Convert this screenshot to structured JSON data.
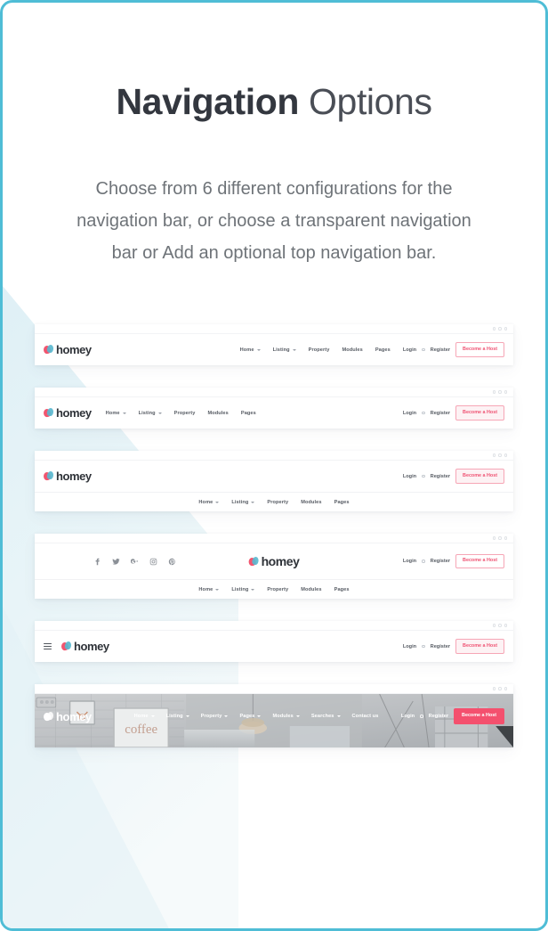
{
  "theme": {
    "frame_border_color": "#4fbdd6",
    "accent_pink": "#f4506e",
    "wedge_color": "#e4f3f7",
    "title_color": "#33373f",
    "body_text_color": "#6e7378"
  },
  "header": {
    "title_bold": "Navigation",
    "title_light": "Options",
    "subtitle": "Choose from 6 different configurations for the navigation bar, or choose a transparent navigation bar or Add an optional top navigation bar."
  },
  "brand": {
    "name": "homey",
    "logo_icon": "heart-logo-icon"
  },
  "common": {
    "login_label": "Login",
    "register_label": "Register",
    "host_button_label": "Become a Host",
    "window_dots": 3
  },
  "menus": {
    "standard": [
      {
        "label": "Home",
        "has_caret": true
      },
      {
        "label": "Listing",
        "has_caret": true
      },
      {
        "label": "Property",
        "has_caret": false
      },
      {
        "label": "Modules",
        "has_caret": false
      },
      {
        "label": "Pages",
        "has_caret": false
      }
    ],
    "extended": [
      {
        "label": "Home",
        "has_caret": true
      },
      {
        "label": "Listing",
        "has_caret": true
      },
      {
        "label": "Property",
        "has_caret": true
      },
      {
        "label": "Pages",
        "has_caret": true
      },
      {
        "label": "Modules",
        "has_caret": true
      },
      {
        "label": "Searches",
        "has_caret": true
      },
      {
        "label": "Contact us",
        "has_caret": false
      }
    ]
  },
  "socials": [
    {
      "name": "facebook-icon",
      "glyph": "f"
    },
    {
      "name": "twitter-icon",
      "glyph": "t"
    },
    {
      "name": "google-plus-icon",
      "glyph": "g"
    },
    {
      "name": "instagram-icon",
      "glyph": "i"
    },
    {
      "name": "pinterest-icon",
      "glyph": "p"
    }
  ],
  "mockups": [
    {
      "id": "nav-variant-1",
      "description": "Logo left, menu and account right, outlined host button"
    },
    {
      "id": "nav-variant-2",
      "description": "Logo with menu left, account right, tinted host button"
    },
    {
      "id": "nav-variant-3",
      "description": "Logo left with account right, centered menu on second row"
    },
    {
      "id": "nav-variant-4",
      "description": "Social icons left, centered logo, account right, centered menu second row"
    },
    {
      "id": "nav-variant-5",
      "description": "Hamburger and logo left, account right"
    },
    {
      "id": "nav-variant-6",
      "description": "Transparent nav over hero photo, white text, solid host button"
    }
  ],
  "photo": {
    "alt": "Interior room with white brick wall, framed coffee print and pendant lamp",
    "frame_text": "coffee"
  }
}
